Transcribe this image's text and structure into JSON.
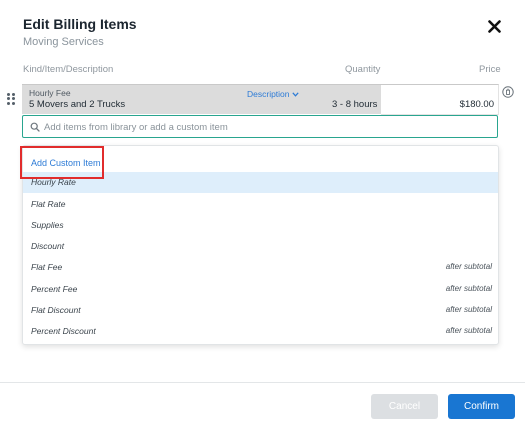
{
  "modal": {
    "title": "Edit Billing Items",
    "subtitle": "Moving Services"
  },
  "columns": {
    "kind": "Kind/Item/Description",
    "quantity": "Quantity",
    "price": "Price"
  },
  "line_item": {
    "kind": "Hourly Fee",
    "description": "5 Movers and 2 Trucks",
    "description_toggle": "Description",
    "quantity": "3 - 8 hours",
    "price": "$180.00"
  },
  "search": {
    "placeholder": "Add items from library or add a custom item",
    "value": ""
  },
  "dropdown": {
    "add_custom_label": "Add Custom Item",
    "options": [
      {
        "label": "Hourly Rate",
        "note": "",
        "highlighted": true
      },
      {
        "label": "Flat Rate",
        "note": ""
      },
      {
        "label": "Supplies",
        "note": ""
      },
      {
        "label": "Discount",
        "note": ""
      },
      {
        "label": "Flat Fee",
        "note": "after subtotal"
      },
      {
        "label": "Percent Fee",
        "note": "after subtotal"
      },
      {
        "label": "Flat Discount",
        "note": "after subtotal"
      },
      {
        "label": "Percent Discount",
        "note": "after subtotal"
      }
    ]
  },
  "footer": {
    "cancel_label": "Cancel",
    "confirm_label": "Confirm"
  },
  "colors": {
    "accent": "#1976d2",
    "link": "#2d7bd6",
    "focus_border": "#29a58f",
    "highlight_box": "#e12c2c",
    "option_hover": "#deeefb"
  },
  "icons": {
    "close": "close-icon",
    "drag": "drag-handle-icon",
    "search": "search-icon",
    "delete": "delete-icon",
    "chevron": "chevron-down-icon"
  }
}
